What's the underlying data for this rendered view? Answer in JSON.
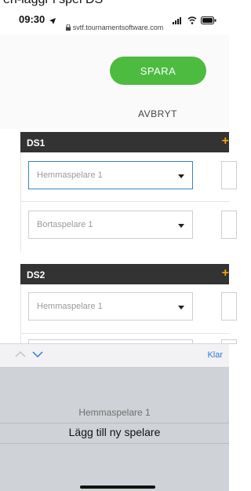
{
  "top_partial": "en-läggr i spel DS",
  "status": {
    "time": "09:30",
    "url": "svtf.tournamentsoftware.com"
  },
  "actions": {
    "save": "SPARA",
    "cancel": "AVBRYT"
  },
  "sections": [
    {
      "title": "DS1",
      "add_symbol": "+",
      "home_select": "Hemmaspelare 1",
      "away_select": "Bortaspelare 1"
    },
    {
      "title": "DS2",
      "add_symbol": "+",
      "home_select": "Hemmaspelare 1"
    }
  ],
  "toolbar": {
    "done": "Klar"
  },
  "picker": {
    "options": [
      "Hemmaspelare 1",
      "Lägg till ny spelare"
    ]
  },
  "icons": {
    "location": "location-arrow-icon",
    "lock": "lock-icon",
    "signal": "signal-icon",
    "wifi": "wifi-icon",
    "battery": "battery-icon",
    "up": "chevron-up-icon",
    "down": "chevron-down-icon"
  },
  "colors": {
    "save": "#4cbb40",
    "header": "#333333",
    "plus": "#f0a30a",
    "link": "#2a7ae2"
  }
}
